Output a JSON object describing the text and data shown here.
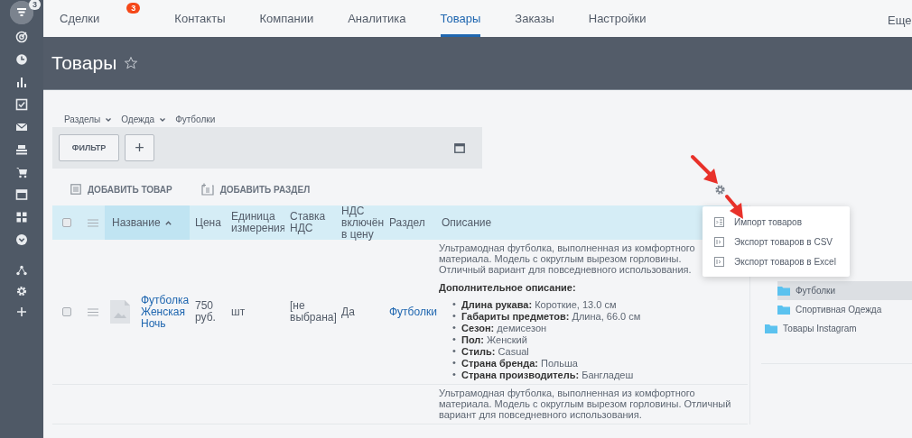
{
  "sidebar": {
    "badge": "3"
  },
  "tabs": [
    {
      "label": "Сделки",
      "selected": false,
      "badge": "3"
    },
    {
      "label": "Контакты",
      "selected": false
    },
    {
      "label": "Компании",
      "selected": false
    },
    {
      "label": "Аналитика",
      "selected": false
    },
    {
      "label": "Товары",
      "selected": true
    },
    {
      "label": "Заказы",
      "selected": false
    },
    {
      "label": "Настройки",
      "selected": false
    }
  ],
  "more": "Еще",
  "page_title": "Товары",
  "breadcrumbs": [
    {
      "label": "Разделы",
      "dropdown": true
    },
    {
      "label": "Одежда",
      "dropdown": true
    },
    {
      "label": "Футболки",
      "dropdown": false
    }
  ],
  "filter": {
    "button": "ФИЛЬТР",
    "add": "+"
  },
  "actions": [
    {
      "label": "ДОБАВИТЬ ТОВАР",
      "kind": "item"
    },
    {
      "label": "ДОБАВИТЬ РАЗДЕЛ",
      "kind": "section"
    }
  ],
  "table": {
    "header_checked": false,
    "columns": [
      {
        "label": "Название",
        "sorted": true
      },
      {
        "label": "Цена",
        "sorted": false
      },
      {
        "label": "Единица измерения",
        "sorted": false
      },
      {
        "label": "Ставка НДС",
        "sorted": false
      },
      {
        "label": "НДС включён в цену",
        "sorted": false
      },
      {
        "label": "Раздел",
        "sorted": false
      },
      {
        "label": "Описание",
        "sorted": false
      }
    ],
    "rows": [
      {
        "checked": false,
        "name": "Футболка Женская Ночь",
        "price": "750 руб.",
        "unit": "шт",
        "vat_rate": "[не выбрана]",
        "vat_included": "Да",
        "section": "Футболки",
        "description": "Ультрамодная футболка, выполненная из комфортного материала. Модель с округлым вырезом горловины. Отличный вариант для повседневного использования.",
        "details_title": "Дополнительное описание:",
        "details": [
          {
            "marker": "•",
            "text": "**Длина рукава:** Короткие, 13.0 см"
          },
          {
            "marker": "•",
            "text": "**Габариты предметов:** Длина, 66.0 см"
          },
          {
            "marker": "•",
            "text": "**Сезон:** демисезон"
          },
          {
            "marker": "•",
            "text": "**Пол:** Женский"
          },
          {
            "marker": "•",
            "text": "**Стиль:** Casual"
          },
          {
            "marker": "•",
            "text": "**Страна бренда:** Польша"
          },
          {
            "marker": "•",
            "text": "**Страна производитель:** Бангладеш"
          }
        ]
      },
      {
        "description": "Ультрамодная футболка, выполненная из комфортного материала. Модель с округлым вырезом горловины. Отличный вариант для повседневного использования."
      }
    ]
  },
  "tree": [
    {
      "children": [
        {
          "label": "Футболки",
          "selected": true
        },
        {
          "label": "Спортивная Одежда",
          "selected": false
        }
      ]
    },
    {
      "label": "Товары Instagram",
      "selected": false
    }
  ],
  "context_menu": {
    "items": [
      {
        "label": "Импорт товаров",
        "kind": "import"
      },
      {
        "label": "Экспорт товаров в CSV",
        "kind": "export"
      },
      {
        "label": "Экспорт товаров в Excel",
        "kind": "export"
      }
    ]
  }
}
